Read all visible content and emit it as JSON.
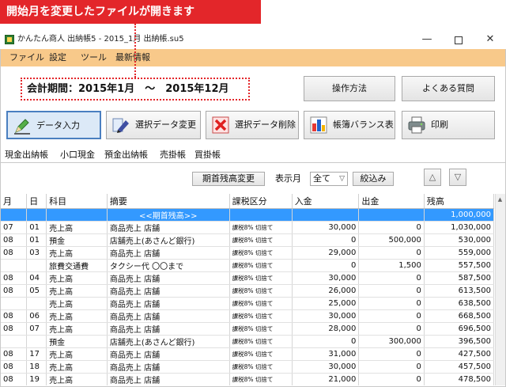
{
  "callout": "開始月を変更したファイルが開きます",
  "window": {
    "title": "かんたん商人 出納帳5 - 2015_1月 出納帳.su5",
    "min": "—",
    "close": "✕"
  },
  "menu": [
    "ファイル",
    "設定",
    "ツール",
    "最新情報"
  ],
  "period": "会計期間：2015年1月　～　2015年12月",
  "buttons": {
    "howto": "操作方法",
    "faq": "よくある質問"
  },
  "toolbar": {
    "entry": "データ入力",
    "change": "選択データ変更",
    "delete": "選択データ削除",
    "balance": "帳簿バランス表",
    "print": "印刷"
  },
  "tabs": [
    "現金出納帳",
    "小口現金",
    "預金出納帳",
    "売掛帳",
    "買掛帳"
  ],
  "filter": {
    "opening": "期首残高変更",
    "month_label": "表示月",
    "month_value": "全て",
    "narrow": "絞込み",
    "up": "△",
    "down": "▽"
  },
  "table": {
    "headers": [
      "月",
      "日",
      "科目",
      "摘要",
      "課税区分",
      "入金",
      "出金",
      "残高"
    ],
    "rows": [
      [
        "",
        "",
        "",
        "<<期首残高>>",
        "",
        "",
        "",
        "1,000,000"
      ],
      [
        "07",
        "01",
        "売上高",
        "商品売上 店舗",
        "課税8% 切捨て",
        "30,000",
        "0",
        "1,030,000"
      ],
      [
        "08",
        "01",
        "預金",
        "店舗売上(あさんど銀行)",
        "課税8% 切捨て",
        "0",
        "500,000",
        "530,000"
      ],
      [
        "08",
        "03",
        "売上高",
        "商品売上 店舗",
        "課税8% 切捨て",
        "29,000",
        "0",
        "559,000"
      ],
      [
        "",
        "",
        "旅費交通費",
        "タクシー代 〇〇まで",
        "課税8% 切捨て",
        "0",
        "1,500",
        "557,500"
      ],
      [
        "08",
        "04",
        "売上高",
        "商品売上 店舗",
        "課税8% 切捨て",
        "30,000",
        "0",
        "587,500"
      ],
      [
        "08",
        "05",
        "売上高",
        "商品売上 店舗",
        "課税8% 切捨て",
        "26,000",
        "0",
        "613,500"
      ],
      [
        "",
        "",
        "売上高",
        "商品売上 店舗",
        "課税8% 切捨て",
        "25,000",
        "0",
        "638,500"
      ],
      [
        "08",
        "06",
        "売上高",
        "商品売上 店舗",
        "課税8% 切捨て",
        "30,000",
        "0",
        "668,500"
      ],
      [
        "08",
        "07",
        "売上高",
        "商品売上 店舗",
        "課税8% 切捨て",
        "28,000",
        "0",
        "696,500"
      ],
      [
        "",
        "",
        "預金",
        "店舗売上(あさんど銀行)",
        "課税8% 切捨て",
        "0",
        "300,000",
        "396,500"
      ],
      [
        "08",
        "17",
        "売上高",
        "商品売上 店舗",
        "課税8% 切捨て",
        "31,000",
        "0",
        "427,500"
      ],
      [
        "08",
        "18",
        "売上高",
        "商品売上 店舗",
        "課税8% 切捨て",
        "30,000",
        "0",
        "457,500"
      ],
      [
        "08",
        "19",
        "売上高",
        "商品売上 店舗",
        "課税8% 切捨て",
        "21,000",
        "0",
        "478,500"
      ]
    ]
  }
}
